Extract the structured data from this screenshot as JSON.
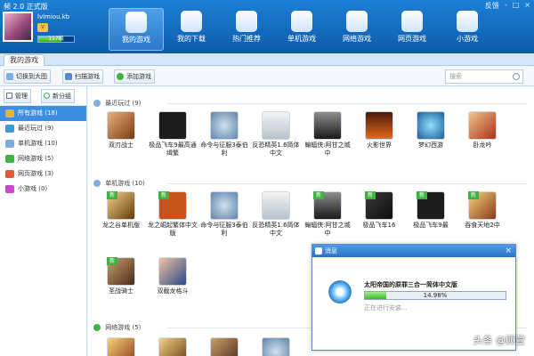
{
  "app": {
    "title": "频 2.0 正式版"
  },
  "window": {
    "feedback": "反馈",
    "minimize": "-",
    "maximize": "□",
    "close": "×"
  },
  "user": {
    "name": "lvlmiou.kb",
    "vip": "V",
    "level": "117级",
    "level_fraction": 0.65
  },
  "nav": [
    {
      "label": "我的游戏",
      "icon": "gamepad-user-icon"
    },
    {
      "label": "我的下载",
      "icon": "download-icon"
    },
    {
      "label": "热门推荐",
      "icon": "hot-icon"
    },
    {
      "label": "单机游戏",
      "icon": "controller-icon"
    },
    {
      "label": "网络游戏",
      "icon": "globe-icon"
    },
    {
      "label": "网页游戏",
      "icon": "web-icon"
    },
    {
      "label": "小游戏",
      "icon": "joystick-icon"
    }
  ],
  "tabs": {
    "active": "我的游戏"
  },
  "toolbar": {
    "switch_view": "切换到大图",
    "scan": "扫描游戏",
    "add": "添加游戏",
    "search_placeholder": "搜索"
  },
  "sidebar": {
    "manage": "管理",
    "new_group": "新分组",
    "categories": [
      {
        "label": "所有游戏 (18)",
        "color": "#f0b13a"
      },
      {
        "label": "最近玩过 (9)",
        "color": "#3a9ad8"
      },
      {
        "label": "单机游戏 (10)",
        "color": "#7ab0e0"
      },
      {
        "label": "网络游戏 (5)",
        "color": "#3fb33f"
      },
      {
        "label": "网页游戏 (3)",
        "color": "#e05a3a"
      },
      {
        "label": "小游戏 (0)",
        "color": "#c84ac8"
      }
    ]
  },
  "sections": {
    "recent": "最近玩过 (9)",
    "single": "单机游戏 (10)",
    "online": "网络游戏 (5)"
  },
  "recent_games": [
    {
      "name": "双刃战士",
      "icon": "dl-icon-a"
    },
    {
      "name": "极品飞车9最高通缉繁",
      "icon": "g-mw"
    },
    {
      "name": "命令与征服3泰伯利",
      "icon": "g-cc"
    },
    {
      "name": "反恐精英1.6简体中文",
      "icon": "g-cs"
    },
    {
      "name": "蝙蝠侠:阿甘之城中",
      "icon": "g-bat"
    },
    {
      "name": "火影世界",
      "icon": "g-fire"
    },
    {
      "name": "梦幻西游",
      "icon": "g-dream"
    },
    {
      "name": "卧龙吟",
      "icon": "g-tiger"
    }
  ],
  "single_games": [
    {
      "name": "龙之谷单机版",
      "icon": "g-dragon",
      "new": "新"
    },
    {
      "name": "龙之崛起繁体中文版",
      "icon": "g-cheng",
      "new": "新"
    },
    {
      "name": "命令与征服3泰伯利",
      "icon": "g-cc",
      "new": ""
    },
    {
      "name": "反恐精英1.6简体中文",
      "icon": "g-cs",
      "new": ""
    },
    {
      "name": "蝙蝠侠:阿甘之城中",
      "icon": "g-bat",
      "new": "新"
    },
    {
      "name": "极品飞车16",
      "icon": "g-nfs",
      "new": "新"
    },
    {
      "name": "极品飞车9最",
      "icon": "g-mw",
      "new": "新"
    },
    {
      "name": "吞食天地2中",
      "icon": "g-war",
      "new": "新"
    }
  ],
  "single_games_row2": [
    {
      "name": "圣战骑士",
      "icon": "g-knight",
      "new": "新"
    },
    {
      "name": "双截龙格斗",
      "icon": "g-fighter",
      "new": ""
    }
  ],
  "popup": {
    "title": "消息",
    "close": "×",
    "game": "太阳帝国的原罪三合一简体中文版",
    "progress_text": "14.98%",
    "progress": 0.1498,
    "status": "正在进行安装..."
  },
  "watermark": "头条 @顾萱"
}
